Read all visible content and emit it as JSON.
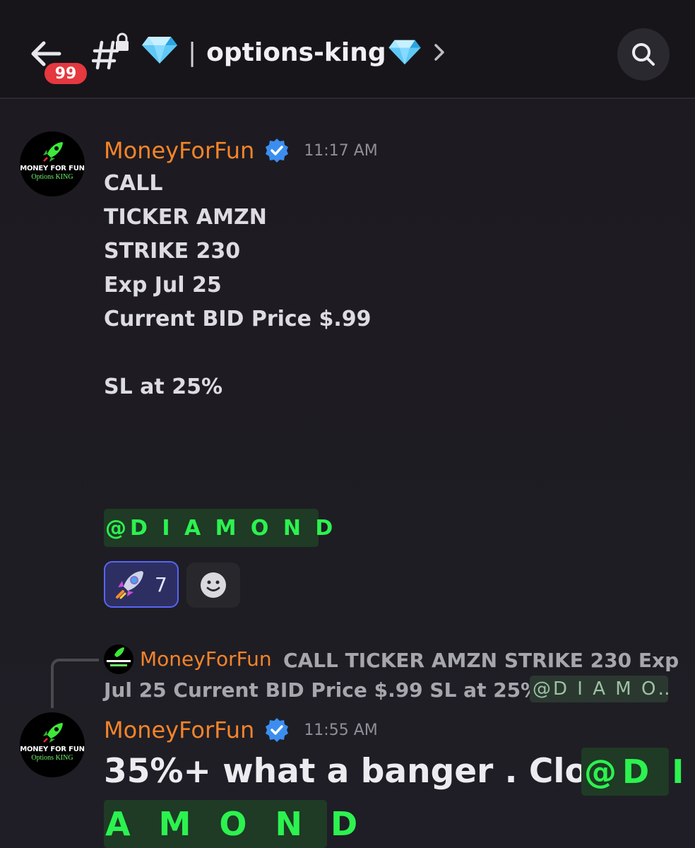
{
  "header": {
    "unread_count": "99",
    "channel_prefix": "|",
    "channel_name": "options-king",
    "icons": [
      "back-arrow-icon",
      "locked-text-channel-icon",
      "diamond-icon",
      "chevron-right-icon",
      "search-icon"
    ]
  },
  "avatar": {
    "line1": "MONEY FOR FUN",
    "line2": "Options KING"
  },
  "messages": [
    {
      "author": "MoneyForFun",
      "time": "11:17 AM",
      "lines": [
        "CALL",
        "TICKER  AMZN",
        "STRIKE 230",
        "Exp Jul 25",
        "Current BID Price $.99",
        "",
        "SL at 25%"
      ],
      "mention": "@D I A M O N D",
      "reactions": [
        {
          "emoji": "rocket",
          "count": "7"
        }
      ]
    },
    {
      "reply_to": {
        "author": "MoneyForFun",
        "preview_line1": "CALL TICKER  AMZN STRIKE 230 Exp",
        "preview_line2": "Jul 25 Current BID Price $.99  SL at 25%",
        "mention_preview": "@D I A M O…"
      },
      "author": "MoneyForFun",
      "time": "11:55 AM",
      "text": "35%+ what a banger . Close",
      "mention_part1": "@D I",
      "mention_part2": "A M O N D"
    }
  ],
  "colors": {
    "username": "#f5842a",
    "mention_text": "#2cf24f",
    "mention_bg": "#1f3a25",
    "badge": "#e5383f",
    "verified": "#3b8ef0",
    "reaction_border": "#5865f2"
  }
}
